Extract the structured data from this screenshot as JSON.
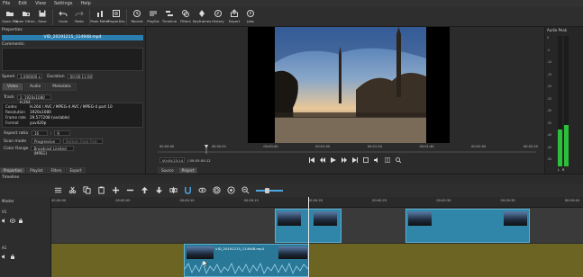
{
  "menu": [
    "File",
    "Edit",
    "View",
    "Settings",
    "Help"
  ],
  "toolbar": [
    {
      "label": "Open File",
      "icon": "folder-icon"
    },
    {
      "label": "Open Other...",
      "icon": "open-other-icon"
    },
    {
      "label": "Save",
      "icon": "save-icon"
    },
    {
      "label": "Undo",
      "icon": "undo-icon"
    },
    {
      "label": "Redo",
      "icon": "redo-icon"
    },
    {
      "label": "Peak Meter",
      "icon": "peak-meter-icon"
    },
    {
      "label": "Properties",
      "icon": "properties-icon"
    },
    {
      "label": "Recent",
      "icon": "recent-icon"
    },
    {
      "label": "Playlist",
      "icon": "playlist-icon"
    },
    {
      "label": "Timeline",
      "icon": "timeline-icon"
    },
    {
      "label": "Filters",
      "icon": "filters-icon"
    },
    {
      "label": "Keyframes",
      "icon": "keyframes-icon"
    },
    {
      "label": "History",
      "icon": "history-icon"
    },
    {
      "label": "Export",
      "icon": "export-icon"
    },
    {
      "label": "Jobs",
      "icon": "jobs-icon"
    }
  ],
  "properties": {
    "panel_title": "Properties",
    "clip_name": "VID_20191215_114948.mp4",
    "comments_label": "Comments:",
    "speed_label": "Speed",
    "speed_value": "1.000000 x",
    "duration_label": "Duration",
    "duration_value": "00:00:11:00",
    "tabs": [
      "Video",
      "Audio",
      "Metadata"
    ],
    "track_label": "Track",
    "track_value": "1: 1920x1080 H.264",
    "info": [
      {
        "k": "Codec",
        "v": "H.264 / AVC / MPEG-4 AVC / MPEG-4 part 10"
      },
      {
        "k": "Resolution",
        "v": "1920x1080"
      },
      {
        "k": "Frame rate",
        "v": "29.577208 (variable)"
      },
      {
        "k": "Format",
        "v": "yuv420p"
      }
    ],
    "aspect_label": "Aspect ratio",
    "aspect_a": "16",
    "aspect_b": "9",
    "scan_label": "Scan mode",
    "scan_value": "Progressive",
    "field_order": "Bottom Field First",
    "color_range_label": "Color Range",
    "color_range_value": "Broadcast Limited (MPEG)",
    "bottom_tabs": [
      "Properties",
      "Playlist",
      "Filters",
      "Export"
    ]
  },
  "player": {
    "ruler_ticks": [
      "00:00:00",
      "00:00:20",
      "00:00:40",
      "00:01:00",
      "00:01:20",
      "00:01:40",
      "00:02:00",
      "00:02:20"
    ],
    "current_time": "00:00:23:14",
    "total_time": "/ 00:03:00:12",
    "tabs": [
      "Source",
      "Project"
    ]
  },
  "audio_peak": {
    "title": "Audio Peak",
    "scale": [
      "0",
      "-5",
      "-10",
      "-15",
      "-20",
      "-25",
      "-30",
      "-35",
      "-40",
      "-45",
      "-50"
    ],
    "channels": [
      "L",
      "R"
    ],
    "levels": [
      0.28,
      0.32
    ]
  },
  "timeline": {
    "title": "Timeline",
    "master_label": "Master",
    "v_track": "V1",
    "a_track": "A1",
    "ruler_ticks": [
      "00:00:00",
      "00:00:05",
      "00:00:10",
      "00:00:15",
      "00:00:20",
      "00:00:25",
      "00:00:30",
      "00:00:35",
      "00:00:40"
    ],
    "audio_clip_name": "VID_20191215_114948.mp4"
  },
  "colors": {
    "accent": "#2a7fb0",
    "video_clip": "#2f86a8",
    "audio_track": "#6b6422",
    "meter_green": "#2bbf3a"
  }
}
